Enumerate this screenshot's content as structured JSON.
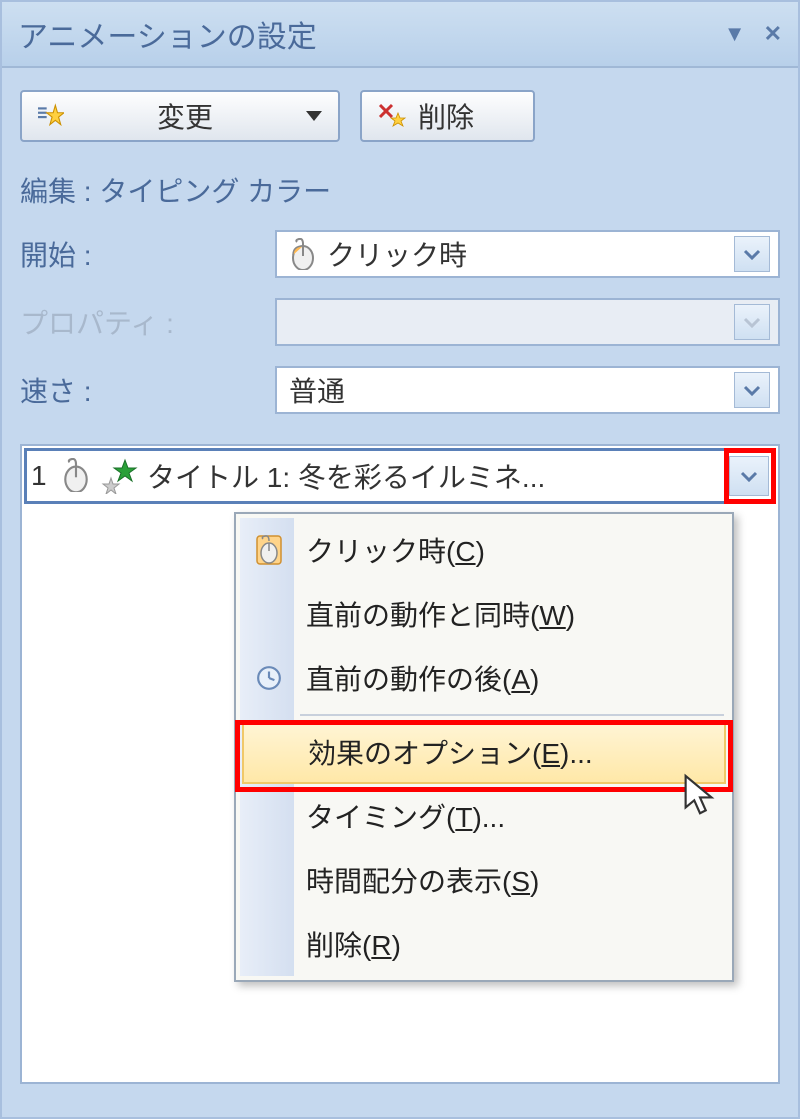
{
  "titlebar": {
    "title": "アニメーションの設定"
  },
  "toolbar": {
    "change_label": "変更",
    "remove_label": "削除"
  },
  "edit_label": "編集 : タイピング カラー",
  "form": {
    "start_label": "開始 :",
    "start_value": "クリック時",
    "property_label": "プロパティ :",
    "property_value": "",
    "speed_label": "速さ :",
    "speed_value": "普通"
  },
  "list": {
    "item_num": "1",
    "item_text": "タイトル 1: 冬を彩るイルミネ..."
  },
  "menu": {
    "items": [
      {
        "label_pre": "クリック時(",
        "key": "C",
        "label_post": ")",
        "icon": "mouse",
        "highlighted": false
      },
      {
        "label_pre": "直前の動作と同時(",
        "key": "W",
        "label_post": ")",
        "icon": "",
        "highlighted": false
      },
      {
        "label_pre": "直前の動作の後(",
        "key": "A",
        "label_post": ")",
        "icon": "clock",
        "highlighted": false
      },
      {
        "sep": true
      },
      {
        "label_pre": "効果のオプション(",
        "key": "E",
        "label_post": ")...",
        "icon": "",
        "highlighted": true
      },
      {
        "label_pre": "タイミング(",
        "key": "T",
        "label_post": ")...",
        "icon": "",
        "highlighted": false
      },
      {
        "label_pre": "時間配分の表示(",
        "key": "S",
        "label_post": ")",
        "icon": "",
        "highlighted": false
      },
      {
        "label_pre": "削除(",
        "key": "R",
        "label_post": ")",
        "icon": "",
        "highlighted": false
      }
    ]
  }
}
